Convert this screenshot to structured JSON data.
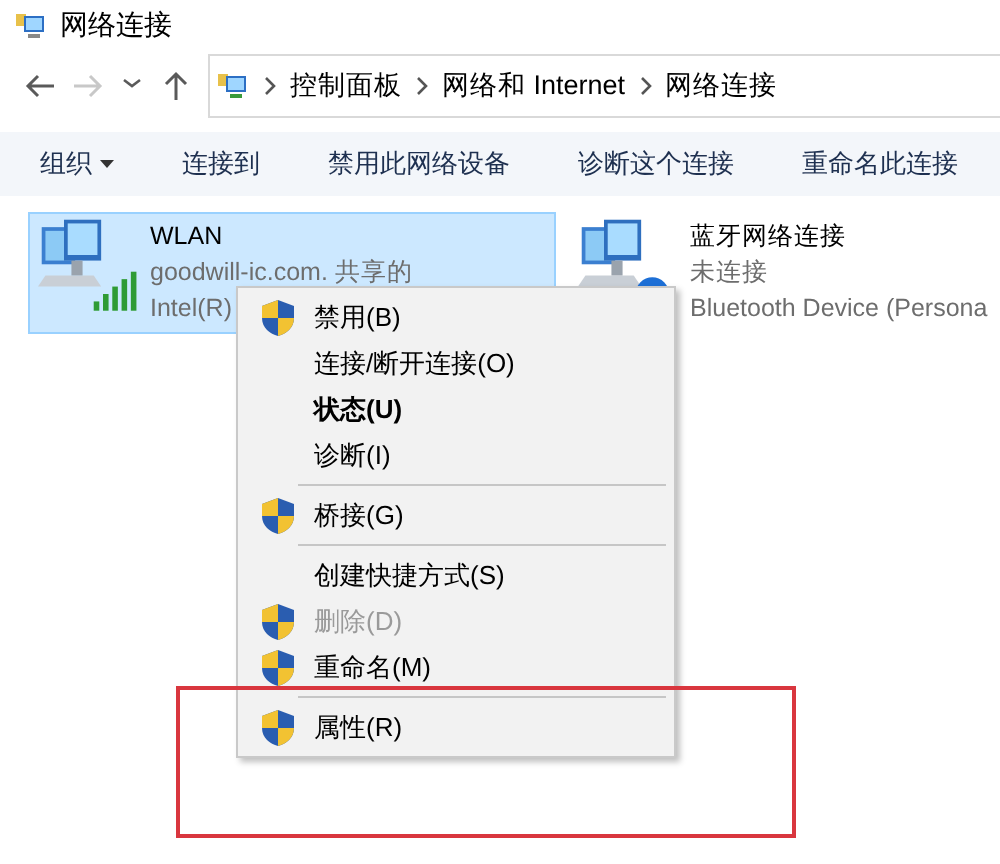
{
  "window": {
    "title": "网络连接"
  },
  "nav": [
    {
      "kind": "back",
      "disabled": false
    },
    {
      "kind": "forward",
      "disabled": true
    },
    {
      "kind": "recent",
      "disabled": false
    },
    {
      "kind": "up",
      "disabled": false
    }
  ],
  "address_bar": {
    "path": [
      "控制面板",
      "网络和 Internet",
      "网络连接"
    ]
  },
  "toolbar": [
    {
      "label": "组织",
      "dropdown": true
    },
    {
      "label": "连接到",
      "dropdown": false
    },
    {
      "label": "禁用此网络设备",
      "dropdown": false
    },
    {
      "label": "诊断这个连接",
      "dropdown": false
    },
    {
      "label": "重命名此连接",
      "dropdown": false
    }
  ],
  "connections": [
    {
      "kind": "wifi",
      "name": "WLAN",
      "lines": [
        "goodwill-ic.com. 共享的",
        "Intel(R)"
      ],
      "selected": true
    },
    {
      "kind": "bluetooth",
      "name": "蓝牙网络连接",
      "lines": [
        "未连接",
        "Bluetooth Device (Persona"
      ],
      "selected": false
    }
  ],
  "context_menu": {
    "items": [
      {
        "kind": "item",
        "label": "禁用(B)",
        "shield": true,
        "bold": false,
        "disabled": false,
        "highlighted": false
      },
      {
        "kind": "item",
        "label": "连接/断开连接(O)",
        "shield": false,
        "bold": false,
        "disabled": false,
        "highlighted": false
      },
      {
        "kind": "item",
        "label": "状态(U)",
        "shield": false,
        "bold": true,
        "disabled": false,
        "highlighted": false
      },
      {
        "kind": "item",
        "label": "诊断(I)",
        "shield": false,
        "bold": false,
        "disabled": false,
        "highlighted": false
      },
      {
        "kind": "separator"
      },
      {
        "kind": "item",
        "label": "桥接(G)",
        "shield": true,
        "bold": false,
        "disabled": false,
        "highlighted": false
      },
      {
        "kind": "separator"
      },
      {
        "kind": "item",
        "label": "创建快捷方式(S)",
        "shield": false,
        "bold": false,
        "disabled": false,
        "highlighted": false
      },
      {
        "kind": "item",
        "label": "删除(D)",
        "shield": true,
        "bold": false,
        "disabled": true,
        "highlighted": false
      },
      {
        "kind": "item",
        "label": "重命名(M)",
        "shield": true,
        "bold": false,
        "disabled": false,
        "highlighted": false
      },
      {
        "kind": "separator"
      },
      {
        "kind": "item",
        "label": "属性(R)",
        "shield": true,
        "bold": false,
        "disabled": false,
        "highlighted": true
      }
    ]
  }
}
